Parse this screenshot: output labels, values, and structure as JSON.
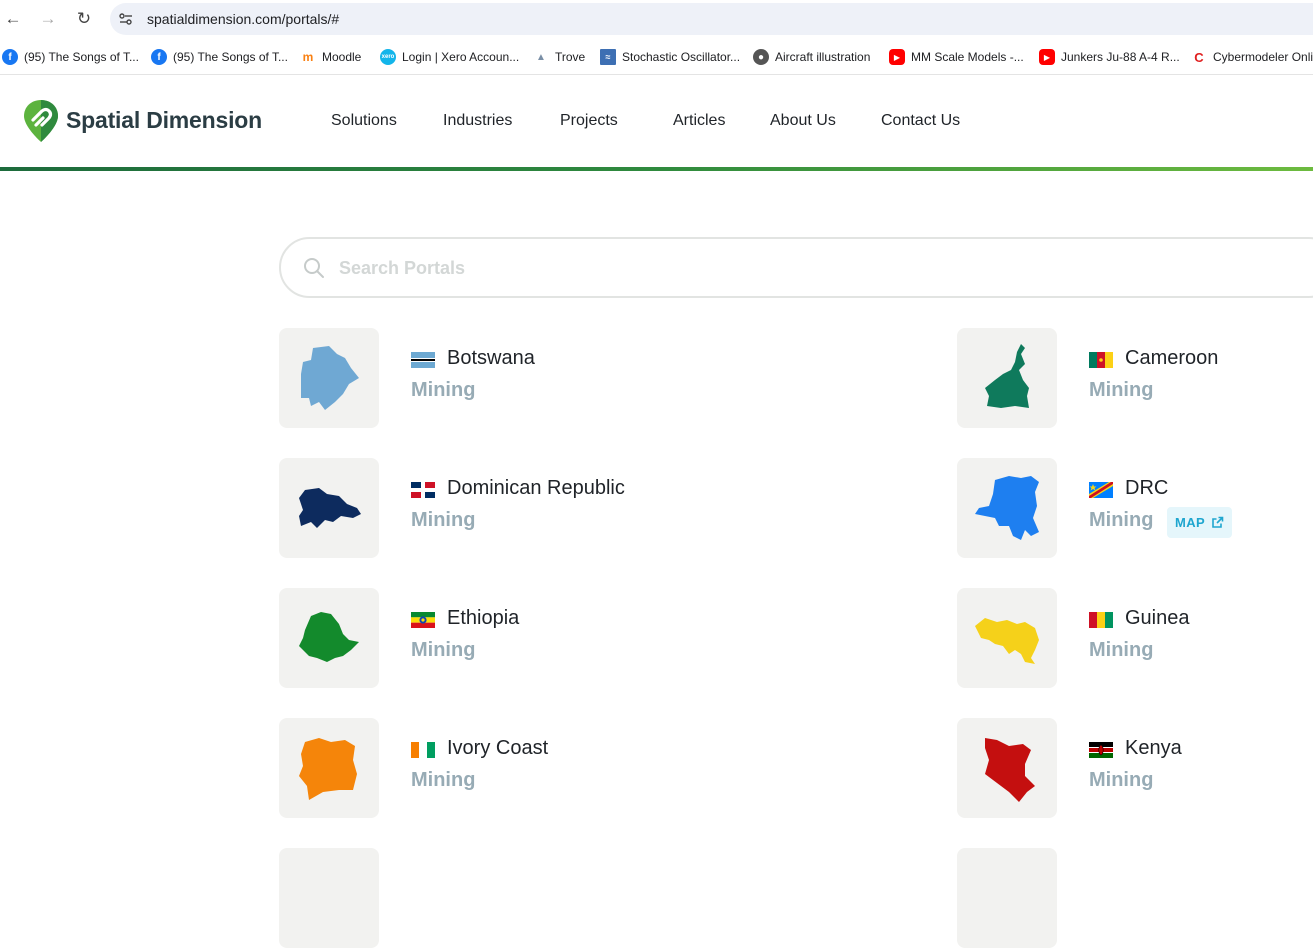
{
  "browser": {
    "url": "spatialdimension.com/portals/#",
    "bookmarks": [
      {
        "label": "(95) The Songs of T...",
        "icon": "facebook-icon"
      },
      {
        "label": "(95) The Songs of T...",
        "icon": "facebook-icon"
      },
      {
        "label": "Moodle",
        "icon": "moodle-icon"
      },
      {
        "label": "Login | Xero Accoun...",
        "icon": "xero-icon"
      },
      {
        "label": "Trove",
        "icon": "trove-icon"
      },
      {
        "label": "Stochastic Oscillator...",
        "icon": "chart-icon"
      },
      {
        "label": "Aircraft illustration",
        "icon": "globe-icon"
      },
      {
        "label": "MM Scale Models -...",
        "icon": "youtube-icon"
      },
      {
        "label": "Junkers Ju-88 A-4 R...",
        "icon": "youtube-icon"
      },
      {
        "label": "Cybermodeler Onli",
        "icon": "cybermodeler-icon"
      }
    ]
  },
  "site": {
    "brand": "Spatial Dimension",
    "nav": [
      "Solutions",
      "Industries",
      "Projects",
      "Articles",
      "About Us",
      "Contact Us"
    ],
    "colors": {
      "brand_green": "#2f8a3e",
      "brand_dark": "#2b3d44",
      "muted": "#97abb5",
      "accent_blue": "#1fa6cf"
    }
  },
  "search": {
    "placeholder": "Search Portals"
  },
  "portals": [
    {
      "country": "Botswana",
      "sector": "Mining",
      "map_color": "#6fa8d3"
    },
    {
      "country": "Cameroon",
      "sector": "Mining",
      "map_color": "#0f7a5c"
    },
    {
      "country": "Dominican Republic",
      "sector": "Mining",
      "map_color": "#0d2b5e"
    },
    {
      "country": "DRC",
      "sector": "Mining",
      "map_color": "#1e7ff0",
      "badge": "MAP"
    },
    {
      "country": "Ethiopia",
      "sector": "Mining",
      "map_color": "#138a2c"
    },
    {
      "country": "Guinea",
      "sector": "Mining",
      "map_color": "#f5d11a"
    },
    {
      "country": "Ivory Coast",
      "sector": "Mining",
      "map_color": "#f5850a"
    },
    {
      "country": "Kenya",
      "sector": "Mining",
      "map_color": "#c40f0f"
    }
  ]
}
